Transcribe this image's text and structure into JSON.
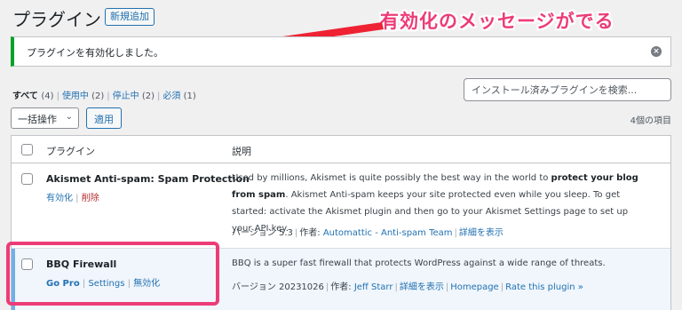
{
  "header": {
    "title": "プラグイン",
    "add_new_label": "新規追加"
  },
  "annotation": {
    "text": "有効化のメッセージがでる",
    "color": "#ec3c78"
  },
  "notice": {
    "message": "プラグインを有効化しました。",
    "dismiss_icon": "close-circle-icon",
    "accent": "#00a32a"
  },
  "filters": {
    "all_label": "すべて",
    "all_count": "(4)",
    "active_label": "使用中",
    "active_count": "(2)",
    "inactive_label": "停止中",
    "inactive_count": "(2)",
    "required_label": "必須",
    "required_count": "(1)"
  },
  "search": {
    "placeholder": "インストール済みプラグインを検索..."
  },
  "bulk": {
    "select_label": "一括操作",
    "apply_label": "適用"
  },
  "items_count": "4個の項目",
  "table": {
    "col_plugin": "プラグイン",
    "col_description": "説明",
    "rows": [
      {
        "name": "Akismet Anti-spam: Spam Protection",
        "actions": [
          "有効化",
          "削除"
        ],
        "desc_before": "Used by millions, Akismet is quite possibly the best way in the world to ",
        "desc_bold1": "protect your blog from spam",
        "desc_after": ". Akismet Anti-spam keeps your site protected even while you sleep. To get started: activate the Akismet plugin and then go to your Akismet Settings page to set up your API key.",
        "version_text": "バージョン 5.3",
        "author_prefix": "作者:",
        "author": "Automattic - Anti-spam Team",
        "details": "詳細を表示"
      },
      {
        "name": "BBQ Firewall",
        "actions": [
          "Go Pro",
          "Settings",
          "無効化"
        ],
        "desc": "BBQ is a super fast firewall that protects WordPress against a wide range of threats.",
        "version_text": "バージョン 20231026",
        "author_prefix": "作者:",
        "author": "Jeff Starr",
        "details": "詳細を表示",
        "homepage": "Homepage",
        "rate": "Rate this plugin »"
      }
    ]
  }
}
